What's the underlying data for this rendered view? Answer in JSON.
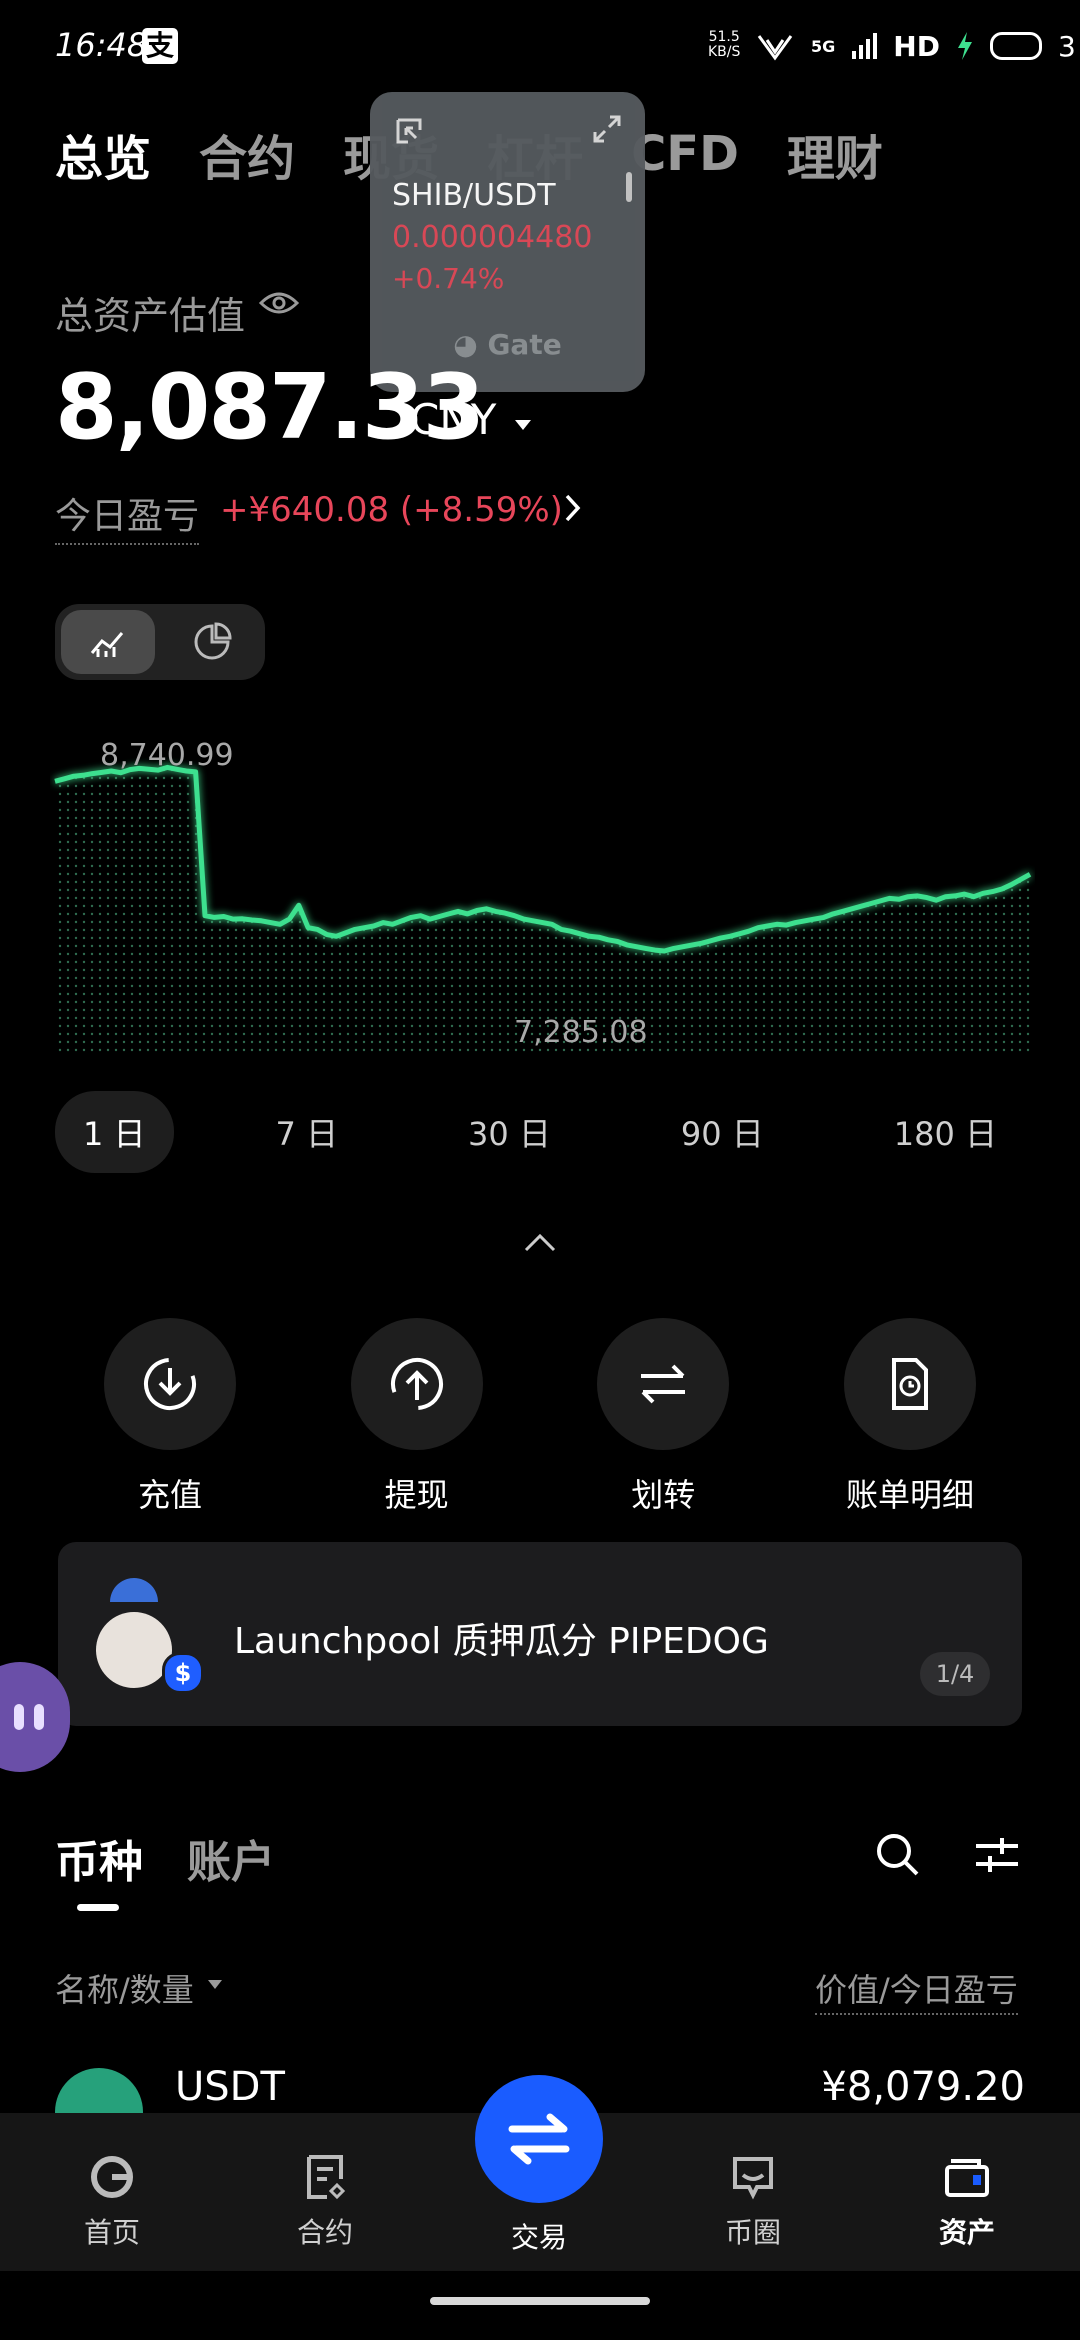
{
  "status_bar": {
    "time": "16:48",
    "pay_badge": "支",
    "net_speed_top": "51.5",
    "net_speed_bottom": "KB/S",
    "signal_5g": "5G",
    "hd": "HD",
    "battery": "3"
  },
  "top_tabs": [
    {
      "label": "总览",
      "active": true
    },
    {
      "label": "合约",
      "active": false
    },
    {
      "label": "现货",
      "active": false
    },
    {
      "label": "杠杆",
      "active": false
    },
    {
      "label": "CFD",
      "active": false
    },
    {
      "label": "理财",
      "active": false
    }
  ],
  "floating_ticker": {
    "pair": "SHIB/USDT",
    "price": "0.000004480",
    "change": "+0.74%",
    "brand": "Gate"
  },
  "overview": {
    "label": "总资产估值",
    "value": "8,087.33",
    "currency": "CNY",
    "pnl_label": "今日盈亏",
    "pnl_value": "+¥640.08 (+8.59%)"
  },
  "chart_data": {
    "type": "area",
    "title": "",
    "xlabel": "",
    "ylabel": "",
    "max_label": "8,740.99",
    "min_label": "7,285.08",
    "ylim": [
      7100,
      8900
    ],
    "values": [
      8660,
      8675,
      8690,
      8695,
      8705,
      8712,
      8720,
      8710,
      8728,
      8735,
      8730,
      8725,
      8740.99,
      8730,
      8720,
      8715,
      7880,
      7870,
      7875,
      7860,
      7862,
      7855,
      7850,
      7840,
      7830,
      7860,
      7940,
      7810,
      7800,
      7770,
      7760,
      7780,
      7800,
      7810,
      7820,
      7840,
      7830,
      7850,
      7870,
      7880,
      7860,
      7875,
      7890,
      7905,
      7890,
      7910,
      7920,
      7905,
      7895,
      7880,
      7860,
      7850,
      7840,
      7830,
      7800,
      7790,
      7775,
      7760,
      7755,
      7740,
      7730,
      7710,
      7700,
      7690,
      7680,
      7675,
      7690,
      7700,
      7710,
      7720,
      7735,
      7750,
      7760,
      7775,
      7790,
      7810,
      7820,
      7830,
      7825,
      7840,
      7850,
      7860,
      7870,
      7890,
      7905,
      7920,
      7935,
      7950,
      7965,
      7980,
      7975,
      7990,
      7995,
      7985,
      7970,
      7990,
      7995,
      8005,
      7990,
      8010,
      8020,
      8035,
      8060,
      8090,
      8120
    ]
  },
  "ranges": [
    {
      "label": "1 日",
      "active": true
    },
    {
      "label": "7 日",
      "active": false
    },
    {
      "label": "30 日",
      "active": false
    },
    {
      "label": "90 日",
      "active": false
    },
    {
      "label": "180 日",
      "active": false
    }
  ],
  "actions": [
    {
      "label": "充值",
      "icon": "deposit-icon"
    },
    {
      "label": "提现",
      "icon": "withdraw-icon"
    },
    {
      "label": "划转",
      "icon": "transfer-icon"
    },
    {
      "label": "账单明细",
      "icon": "bill-icon"
    }
  ],
  "banner": {
    "text": "Launchpool 质押瓜分 PIPEDOG",
    "page": "1/4",
    "badge": "$"
  },
  "section_tabs": {
    "coins": "币种",
    "account": "账户"
  },
  "list_header": {
    "left": "名称/数量",
    "right": "价值/今日盈亏"
  },
  "assets": [
    {
      "name": "USDT",
      "value": "¥8,079.20"
    }
  ],
  "bottom_nav": {
    "home": "首页",
    "futures": "合约",
    "trade": "交易",
    "community": "币圈",
    "assets": "资产"
  },
  "colors": {
    "up": "#e8465a",
    "chart_line": "#3ee08f",
    "accent": "#1a5cff",
    "tether": "#26a17b"
  }
}
